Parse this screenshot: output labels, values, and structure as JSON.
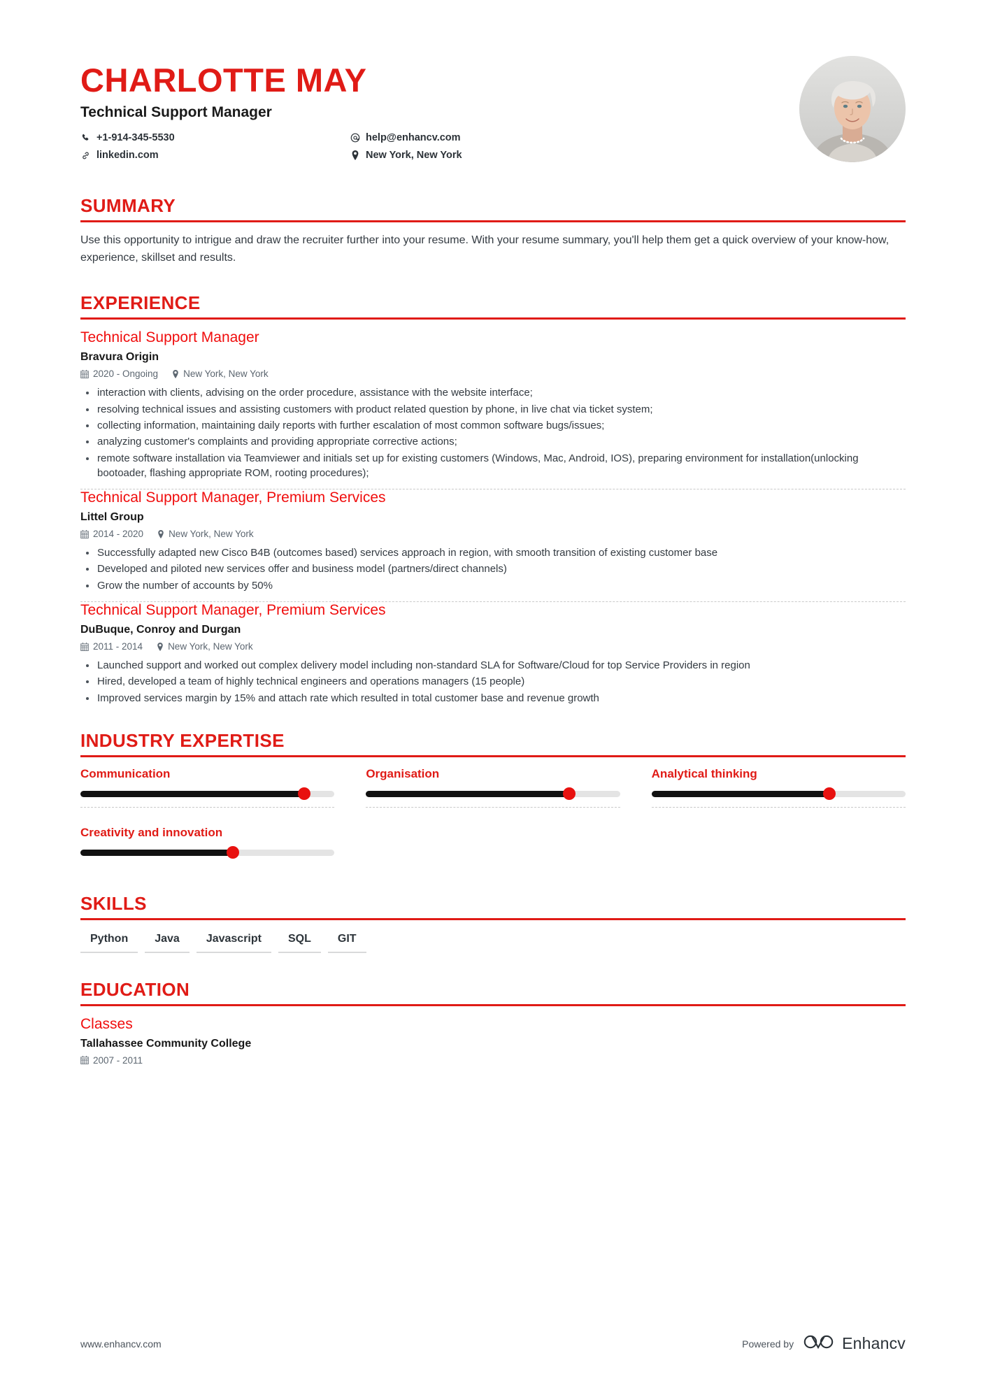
{
  "header": {
    "name": "CHARLOTTE MAY",
    "job_title": "Technical Support Manager",
    "contacts": [
      {
        "icon": "phone-icon",
        "value": "+1-914-345-5530"
      },
      {
        "icon": "email-icon",
        "value": "help@enhancv.com"
      },
      {
        "icon": "link-icon",
        "value": "linkedin.com"
      },
      {
        "icon": "location-icon",
        "value": "New York, New York"
      }
    ],
    "avatar_alt": "profile-photo"
  },
  "summary": {
    "title": "SUMMARY",
    "text": "Use this opportunity to intrigue and draw the recruiter further into your resume. With your resume summary, you'll help them get a quick overview of your know-how, experience, skillset and results."
  },
  "experience": {
    "title": "EXPERIENCE",
    "jobs": [
      {
        "role": "Technical Support Manager",
        "company": "Bravura Origin",
        "dates": "2020 - Ongoing",
        "location": "New York, New York",
        "bullets": [
          "interaction with clients, advising on the order procedure, assistance with the website interface;",
          "resolving technical issues and assisting customers with product related question by phone, in live chat via ticket system;",
          "collecting information, maintaining daily reports with further escalation of most common software bugs/issues;",
          "analyzing customer's complaints and providing appropriate corrective actions;",
          "remote software installation via Teamviewer and initials set up for existing customers (Windows, Mac, Android, IOS), preparing environment for installation(unlocking bootoader, flashing appropriate ROM, rooting procedures);"
        ]
      },
      {
        "role": "Technical Support Manager, Premium Services",
        "company": "Littel Group",
        "dates": "2014 - 2020",
        "location": "New York, New York",
        "bullets": [
          "Successfully adapted new Cisco B4B (outcomes based) services approach in region, with smooth transition of existing customer base",
          "Developed and piloted new services offer and business model (partners/direct channels)",
          "Grow the number of accounts by 50%"
        ]
      },
      {
        "role": "Technical Support Manager, Premium Services",
        "company": "DuBuque, Conroy and Durgan",
        "dates": "2011 - 2014",
        "location": "New York, New York",
        "bullets": [
          "Launched support and worked out complex delivery model including non-standard SLA for Software/Cloud for top Service Providers in region",
          "Hired, developed a team of highly technical engineers and operations managers (15 people)",
          "Improved services margin by 15% and attach rate which resulted in total customer base and revenue growth"
        ]
      }
    ]
  },
  "expertise": {
    "title": "INDUSTRY EXPERTISE",
    "items": [
      {
        "label": "Communication",
        "level": 88
      },
      {
        "label": "Organisation",
        "level": 80
      },
      {
        "label": "Analytical thinking",
        "level": 70
      },
      {
        "label": "Creativity and innovation",
        "level": 60
      }
    ]
  },
  "skills": {
    "title": "SKILLS",
    "items": [
      "Python",
      "Java",
      "Javascript",
      "SQL",
      "GIT"
    ]
  },
  "education": {
    "title": "EDUCATION",
    "entries": [
      {
        "degree": "Classes",
        "school": "Tallahassee Community College",
        "dates": "2007 - 2011"
      }
    ]
  },
  "footer": {
    "url": "www.enhancv.com",
    "powered_by": "Powered by",
    "brand": "Enhancv"
  },
  "colors": {
    "accent": "#e01b16",
    "role_red": "#f00d0d",
    "text": "#333a41",
    "muted": "#5c6670",
    "slider_fill": "#111111",
    "slider_track": "#e4e4e4",
    "knob": "#e8110f"
  }
}
